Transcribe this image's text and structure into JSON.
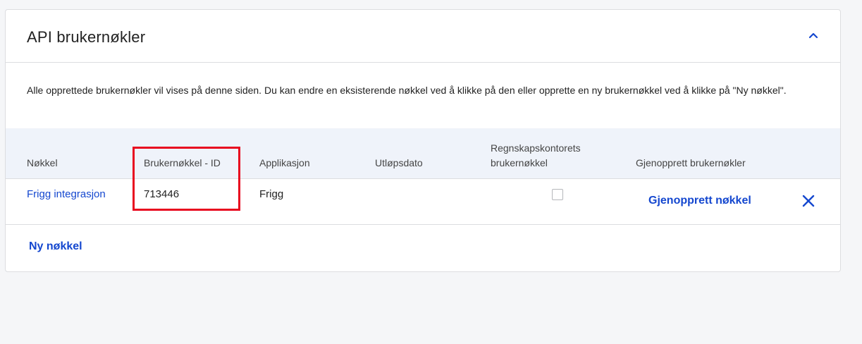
{
  "card": {
    "title": "API brukernøkler",
    "description": "Alle opprettede brukernøkler vil vises på denne siden. Du kan endre en eksisterende nøkkel ved å klikke på den eller opprette en ny brukernøkkel ved å klikke på \"Ny nøkkel\"."
  },
  "table": {
    "headers": {
      "key": "Nøkkel",
      "id": "Brukernøkkel - ID",
      "application": "Applikasjon",
      "expiry": "Utløpsdato",
      "accounting_line1": "Regnskapskontorets",
      "accounting_line2": "brukernøkkel",
      "restore": "Gjenopprett brukernøkler"
    },
    "rows": [
      {
        "key": "Frigg integrasjon",
        "id": "713446",
        "application": "Frigg",
        "expiry": "",
        "accounting_checked": false,
        "restore_label": "Gjenopprett nøkkel"
      }
    ]
  },
  "actions": {
    "new_key": "Ny nøkkel"
  },
  "icons": {
    "collapse": "chevron-up-icon",
    "delete": "close-icon"
  },
  "colors": {
    "link": "#1447cf",
    "highlight": "#e8091f",
    "header_bg": "#eff3fa"
  }
}
